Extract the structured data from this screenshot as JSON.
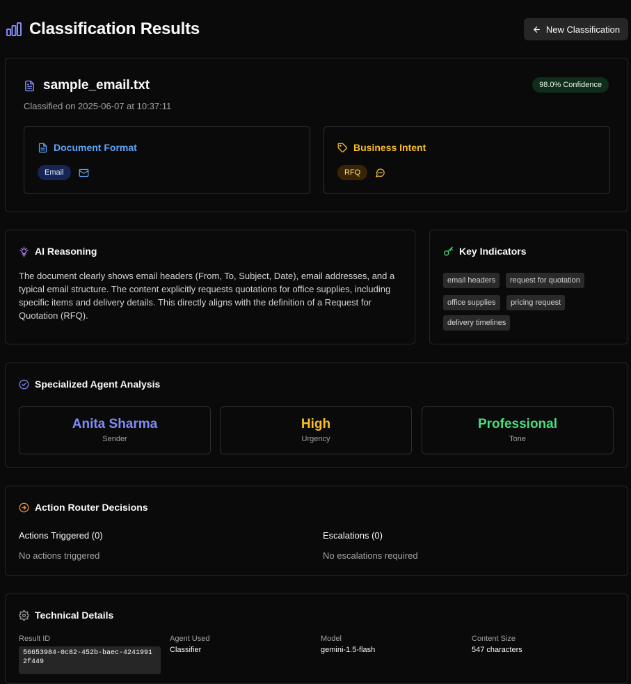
{
  "header": {
    "title": "Classification Results",
    "new_button_label": "New Classification"
  },
  "file": {
    "name": "sample_email.txt",
    "confidence_label": "98.0% Confidence",
    "classified_on": "Classified on 2025-06-07 at 10:37:11"
  },
  "document_format": {
    "heading": "Document Format",
    "value": "Email",
    "icon": "mail-icon"
  },
  "business_intent": {
    "heading": "Business Intent",
    "value": "RFQ",
    "icon": "message-circle-icon"
  },
  "reasoning": {
    "heading": "AI Reasoning",
    "text": "The document clearly shows email headers (From, To, Subject, Date), email addresses, and a typical email structure. The content explicitly requests quotations for office supplies, including specific items and delivery details. This directly aligns with the definition of a Request for Quotation (RFQ)."
  },
  "key_indicators": {
    "heading": "Key Indicators",
    "tags": [
      "email headers",
      "request for quotation",
      "office supplies",
      "pricing request",
      "delivery timelines"
    ]
  },
  "agent_analysis": {
    "heading": "Specialized Agent Analysis",
    "metrics": [
      {
        "value": "Anita Sharma",
        "label": "Sender",
        "color": "#818cf8"
      },
      {
        "value": "High",
        "label": "Urgency",
        "color": "#fbbf24"
      },
      {
        "value": "Professional",
        "label": "Tone",
        "color": "#4ade80"
      }
    ]
  },
  "action_router": {
    "heading": "Action Router Decisions",
    "actions_title": "Actions Triggered (0)",
    "actions_empty": "No actions triggered",
    "escalations_title": "Escalations (0)",
    "escalations_empty": "No escalations required"
  },
  "technical": {
    "heading": "Technical Details",
    "result_id_label": "Result ID",
    "result_id": "56653984-0c82-452b-baec-42419912f449",
    "agent_label": "Agent Used",
    "agent": "Classifier",
    "model_label": "Model",
    "model": "gemini-1.5-flash",
    "size_label": "Content Size",
    "size": "547 characters"
  },
  "colors": {
    "accent_blue": "#60a5fa",
    "accent_amber": "#fbbf24",
    "accent_purple": "#818cf8",
    "accent_green": "#4ade80",
    "accent_orange": "#fb923c"
  }
}
